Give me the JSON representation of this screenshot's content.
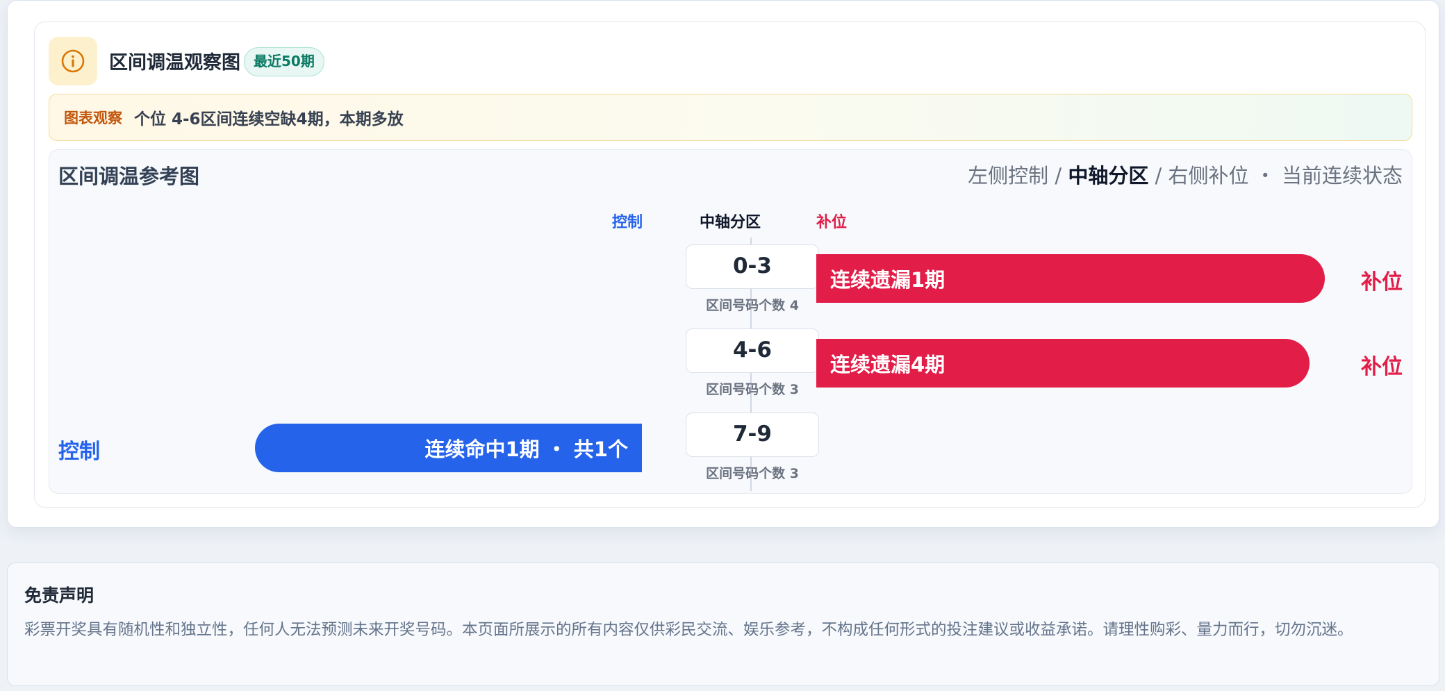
{
  "header": {
    "title": "区间调温观察图",
    "badge": "最近50期",
    "info_icon": "info-icon"
  },
  "observation": {
    "tag": "图表观察",
    "text": "个位 4-6区间连续空缺4期，本期多放"
  },
  "reference": {
    "title": "区间调温参考图",
    "legend_left": "左侧控制 / ",
    "legend_center": "中轴分区",
    "legend_right": " / 右侧补位 ・ 当前连续状态",
    "columns": {
      "control": "控制",
      "axis": "中轴分区",
      "fill": "补位"
    },
    "rows": [
      {
        "zone": "0-3",
        "count_label": "区间号码个数 4",
        "count": 4,
        "side": "fill",
        "bar_text": "连续遗漏1期",
        "side_label": "补位",
        "level": 0.85
      },
      {
        "zone": "4-6",
        "count_label": "区间号码个数 3",
        "count": 3,
        "side": "fill",
        "bar_text": "连续遗漏4期",
        "side_label": "补位",
        "level": 0.82
      },
      {
        "zone": "7-9",
        "count_label": "区间号码个数 3",
        "count": 3,
        "side": "control",
        "bar_text": "连续命中1期 ・ 共1个",
        "side_label": "控制",
        "level": 0.67
      }
    ],
    "colors": {
      "control": "#2563eb",
      "fill": "#e11d48"
    }
  },
  "disclaimer": {
    "title": "免责声明",
    "text": "彩票开奖具有随机性和独立性，任何人无法预测未来开奖号码。本页面所展示的所有内容仅供彩民交流、娱乐参考，不构成任何形式的投注建议或收益承诺。请理性购彩、量力而行，切勿沉迷。"
  }
}
